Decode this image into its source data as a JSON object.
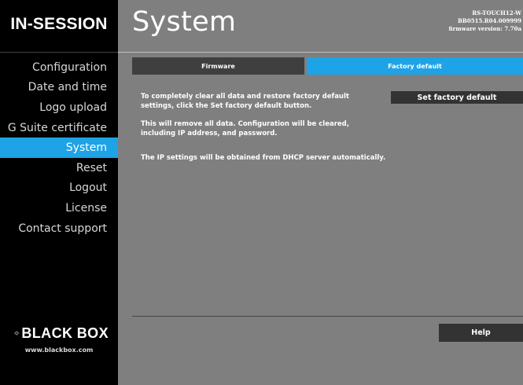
{
  "brand": {
    "name": "IN-SESSION"
  },
  "sidebar": {
    "items": [
      {
        "label": "Configuration"
      },
      {
        "label": "Date and time"
      },
      {
        "label": "Logo upload"
      },
      {
        "label": "G Suite certificate"
      },
      {
        "label": "System",
        "active": true
      },
      {
        "label": "Reset"
      },
      {
        "label": "Logout"
      },
      {
        "label": "License"
      },
      {
        "label": "Contact support"
      }
    ],
    "vendor_logo": "BLACK BOX",
    "vendor_url": "www.blackbox.com"
  },
  "header": {
    "title": "System",
    "device_model": "RS-TOUCH12-W",
    "device_serial": "BB0515.R04.009999",
    "firmware_version": "firmware version: 7.70a"
  },
  "tabs": [
    {
      "label": "Firmware",
      "active": false
    },
    {
      "label": "Factory default",
      "active": true
    }
  ],
  "main": {
    "message_1": "To completely clear all data and restore factory default settings, click the Set factory default button.",
    "message_2": "This will remove all data. Configuration will be cleared, including IP address, and password.",
    "message_3": "The IP settings will be obtained from DHCP server automatically.",
    "set_factory_default_label": "Set factory default"
  },
  "footer": {
    "help_label": "Help"
  },
  "colors": {
    "accent": "#1ea3e6",
    "sidebar_bg": "#000000",
    "content_bg": "#7f7f7f",
    "button_bg": "#333333",
    "inactive_tab_bg": "#3f3f3f"
  }
}
